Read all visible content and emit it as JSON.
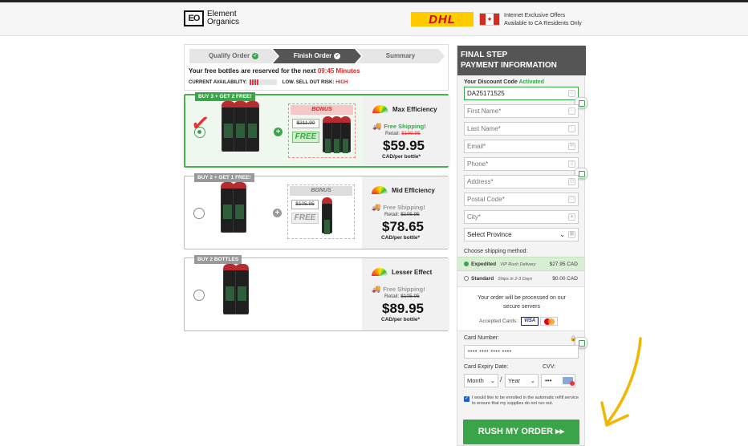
{
  "header": {
    "logo_mark": "EO",
    "brand_line1": "Element",
    "brand_line2": "Organics",
    "carrier": "DHL",
    "notice_line1": "Internet Exclusive Offers",
    "notice_line2": "Available to CA Residents Only"
  },
  "steps": [
    {
      "label": "Qualify Order",
      "state": "done"
    },
    {
      "label": "Finish Order",
      "state": "active"
    },
    {
      "label": "Summary",
      "state": "pending"
    }
  ],
  "reservation": {
    "text": "Your free bottles are reserved for the next",
    "timer": "09:45 Minutes",
    "availability_label": "CURRENT AVAILABILITY:",
    "risk_label": "LOW. SELL OUT RISK:",
    "risk_value": "HIGH"
  },
  "packages": [
    {
      "tag": "BUY 3 + GET 2 FREE!",
      "selected": true,
      "bonus_label": "BONUS",
      "bonus_old_price": "$211.90",
      "bonus_free": "FREE",
      "efficiency": "Max Efficiency",
      "shipping": "Free Shipping!",
      "retail_label": "Retail:",
      "retail_price": "$109.95",
      "price": "$59.95",
      "per": "CAD/per bottle*"
    },
    {
      "tag": "BUY 2 + GET 1 FREE!",
      "selected": false,
      "bonus_label": "BONUS",
      "bonus_old_price": "$105.95",
      "bonus_free": "FREE",
      "efficiency": "Mid Efficiency",
      "shipping": "Free Shipping!",
      "retail_label": "Retail:",
      "retail_price": "$105.95",
      "price": "$78.65",
      "per": "CAD/per bottle*"
    },
    {
      "tag": "BUY 2 BOTTLES",
      "selected": false,
      "efficiency": "Lesser Effect",
      "shipping": "Free Shipping!",
      "retail_label": "Retail:",
      "retail_price": "$105.95",
      "price": "$89.95",
      "per": "CAD/per bottle*"
    }
  ],
  "form": {
    "head_line1": "FINAL STEP",
    "head_line2": "PAYMENT INFORMATION",
    "discount_label": "Your Discount Code",
    "discount_status": "Activated",
    "discount_code": "DA25171525",
    "first_name": "First Name*",
    "last_name": "Last Name*",
    "email": "Email*",
    "phone": "Phone*",
    "address": "Address*",
    "postal": "Postal Code*",
    "city": "City*",
    "province": "Select Province",
    "shipping_label": "Choose shipping method:",
    "ship_options": [
      {
        "name": "Expedited",
        "note": "VIP Rush Delivery",
        "price": "$27.95 CAD",
        "selected": true
      },
      {
        "name": "Standard",
        "note": "Ships in 2-3 Days",
        "price": "$0.00 CAD",
        "selected": false
      }
    ],
    "secure_msg": "Your order will be processed on our secure servers",
    "accepted_label": "Accepted Cards:",
    "visa": "VISA",
    "card_number_label": "Card Number:",
    "card_number_value": "•••• •••• •••• ••••",
    "expiry_label": "Card Expiry Date:",
    "cvv_label": "CVV:",
    "month": "Month",
    "year": "Year",
    "separator": "/",
    "cvv_value": "•••",
    "optin": "I would like to be enrolled in the automatic refill service to ensure that my supplies do not run out.",
    "submit": "RUSH MY ORDER ▸▸"
  }
}
